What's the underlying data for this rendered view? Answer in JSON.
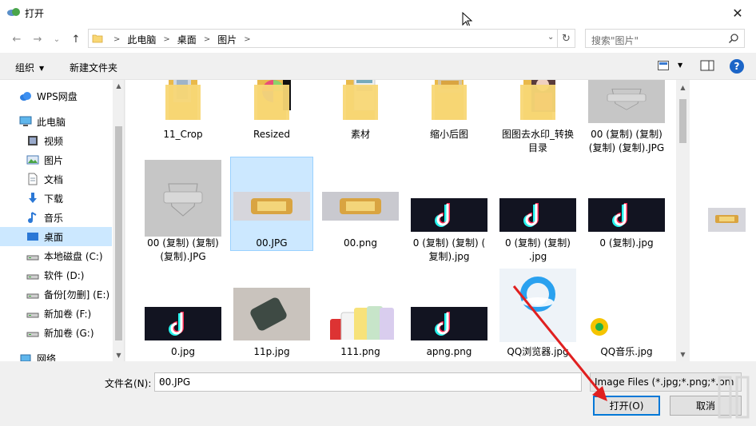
{
  "window": {
    "title": "打开",
    "close_glyph": "✕"
  },
  "nav": {
    "back_glyph": "←",
    "forward_glyph": "→",
    "recent_glyph": "⌄",
    "up_glyph": "↑",
    "breadcrumbs": [
      "此电脑",
      "桌面",
      "图片"
    ],
    "crumb_sep": ">",
    "refresh_glyph": "↻",
    "search_placeholder": "搜索\"图片\""
  },
  "toolbar": {
    "organize": "组织",
    "new_folder": "新建文件夹",
    "help": "?"
  },
  "sidebar": {
    "items": [
      {
        "label": "WPS网盘",
        "icon": "cloud-icon"
      },
      {
        "label": "此电脑",
        "icon": "computer-icon"
      },
      {
        "label": "视频",
        "icon": "video-icon"
      },
      {
        "label": "图片",
        "icon": "pictures-icon"
      },
      {
        "label": "文档",
        "icon": "documents-icon"
      },
      {
        "label": "下载",
        "icon": "download-icon"
      },
      {
        "label": "音乐",
        "icon": "music-icon"
      },
      {
        "label": "桌面",
        "icon": "desktop-icon",
        "selected": true
      },
      {
        "label": "本地磁盘 (C:)",
        "icon": "drive-icon"
      },
      {
        "label": "软件 (D:)",
        "icon": "drive-icon"
      },
      {
        "label": "备份[勿删] (E:)",
        "icon": "drive-icon"
      },
      {
        "label": "新加卷 (F:)",
        "icon": "drive-icon"
      },
      {
        "label": "新加卷 (G:)",
        "icon": "drive-icon"
      },
      {
        "label": "网络",
        "icon": "network-icon"
      }
    ]
  },
  "files": [
    {
      "name": "11_Crop",
      "type": "folder"
    },
    {
      "name": "Resized",
      "type": "folder"
    },
    {
      "name": "素材",
      "type": "folder"
    },
    {
      "name": "缩小后图",
      "type": "folder"
    },
    {
      "name": "图图去水印_转换目录",
      "name_lines": [
        "图图去水印_转换",
        "目录"
      ],
      "type": "folder"
    },
    {
      "name": "00 (复制) (复制) (复制) (复制).JPG",
      "name_lines": [
        "00 (复制) (复制)",
        "(复制) (复制).JPG"
      ],
      "type": "image"
    },
    {
      "name": "00 (复制) (复制) (复制).JPG",
      "name_lines": [
        "00 (复制) (复制)",
        "(复制).JPG"
      ],
      "type": "image"
    },
    {
      "name": "00.JPG",
      "type": "image",
      "selected": true
    },
    {
      "name": "00.png",
      "type": "image"
    },
    {
      "name": "0 (复制) (复制) (复制).jpg",
      "name_lines": [
        "0 (复制) (复制) (",
        "复制).jpg"
      ],
      "type": "image",
      "badge": "音乐"
    },
    {
      "name": "0 (复制) (复制).jpg",
      "name_lines": [
        "0 (复制) (复制)",
        ".jpg"
      ],
      "type": "image",
      "badge": "音乐"
    },
    {
      "name": "0 (复制).jpg",
      "type": "image",
      "badge": "抖音"
    },
    {
      "name": "0.jpg",
      "type": "image",
      "badge": "抖音"
    },
    {
      "name": "11p.jpg",
      "type": "image"
    },
    {
      "name": "111.png",
      "type": "image"
    },
    {
      "name": "apng.png",
      "type": "image",
      "badge": "音乐"
    },
    {
      "name": "QQ浏览器.jpg",
      "type": "image",
      "badge": "QQ浏览器"
    },
    {
      "name": "QQ音乐.jpg",
      "type": "image",
      "badge": "QQ音乐"
    }
  ],
  "bottom": {
    "filename_label": "文件名(N):",
    "filename_value": "00.JPG",
    "filter_value": "Image Files (*.jpg;*.png;*.bm",
    "open_button": "打开(O)",
    "cancel_button": "取消"
  },
  "colors": {
    "selection": "#cce8ff",
    "accent": "#0078d7",
    "arrow": "#e02020"
  }
}
